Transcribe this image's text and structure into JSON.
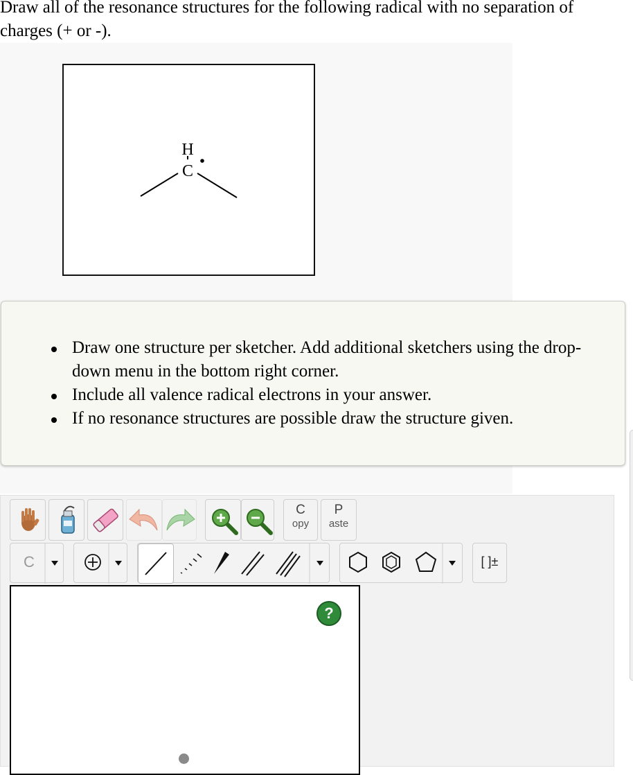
{
  "question": "Draw all of the resonance structures for the following radical with no separation of charges (+ or -).",
  "molecule": {
    "atom_h": "H",
    "atom_c": "C"
  },
  "instructions": [
    "Draw one structure per sketcher. Add additional sketchers using the drop-down menu in the bottom right corner.",
    "Include all valence radical electrons in your answer.",
    "If no resonance structures are possible draw the structure given."
  ],
  "toolbar": {
    "row1": [
      "hand-tool-icon",
      "reagent-bottle-icon",
      "eraser-icon",
      "undo-icon",
      "redo-icon",
      "zoom-in-icon",
      "zoom-out-icon"
    ],
    "copy_top": "C",
    "copy_bottom": "opy",
    "paste_top": "P",
    "paste_bottom": "aste",
    "element_label": "C",
    "bracket_label": "[ ]±",
    "help_label": "?"
  }
}
